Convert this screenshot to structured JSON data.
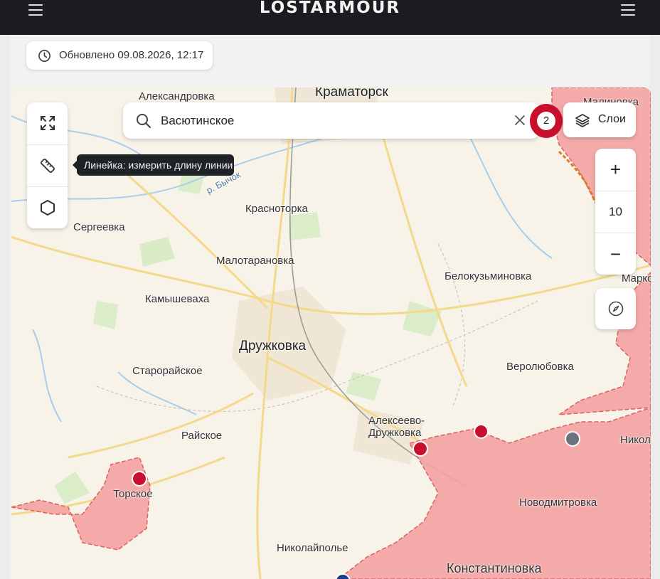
{
  "header": {
    "logo": "LOSTARMOUR",
    "left_menu_icon": "hamburger-icon",
    "right_menu_icon": "hamburger-icon"
  },
  "updated": {
    "text": "Обновлено 09.08.2026, 12:17",
    "icon": "clock-icon"
  },
  "search": {
    "value": "Васютинское",
    "search_icon": "search-icon",
    "clear_icon": "close-icon"
  },
  "tools": {
    "fullscreen_icon": "fullscreen-icon",
    "ruler_icon": "ruler-icon",
    "polygon_icon": "hexagon-icon",
    "tooltip": "Линейка: измерить длину линии"
  },
  "cluster": {
    "count": "2"
  },
  "layers": {
    "label": "Слои",
    "icon": "layers-icon"
  },
  "zoom": {
    "in": "+",
    "level": "10",
    "out": "−"
  },
  "compass_icon": "compass-icon",
  "map": {
    "places": {
      "kramatorsk": "Краматорск",
      "aleksandrovka": "Александровка",
      "malinovka": "Малиновка",
      "river": "р. Бычок",
      "krasnotorka": "Красноторка",
      "sergeevka": "Сергеевка",
      "malotaranovka": "Малотарановка",
      "belokuzminovka": "Белокузьминовка",
      "marko": "Марко",
      "kamyshevakha": "Камышеваха",
      "druzhkovka": "Дружковка",
      "starorayskoe": "Старорайское",
      "verolyubovka": "Веролюбовка",
      "alekseevo1": "Алексеево-",
      "alekseevo2": "Дружковка",
      "rayskoe": "Райское",
      "nikol": "Никол",
      "torskoe": "Торское",
      "novodmitrovka": "Новодмитровка",
      "nikolaypole": "Николайполье",
      "konstantinovka": "Константиновка"
    },
    "colors": {
      "occupied": "#f3a3a3",
      "front_line": "#d9534f",
      "marker_red": "#c8102e",
      "marker_gray": "#6b7280",
      "marker_blue": "#1e3a8a",
      "road": "#f5d98a",
      "green": "#d7ebc4",
      "water": "#a9cdea"
    }
  }
}
